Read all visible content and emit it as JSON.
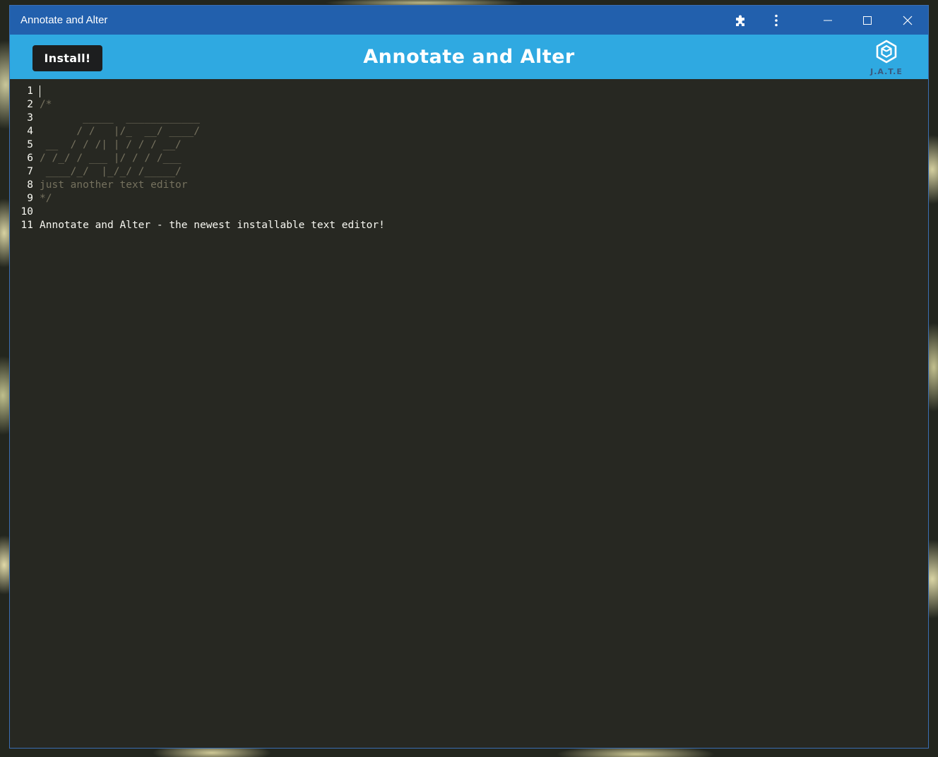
{
  "window": {
    "title": "Annotate and Alter",
    "extensions_icon": "puzzle-icon",
    "menu_icon": "more-vert-icon",
    "minimize_icon": "minimize-icon",
    "maximize_icon": "maximize-icon",
    "close_icon": "close-icon"
  },
  "header": {
    "install_label": "Install!",
    "title": "Annotate and Alter",
    "logo_icon": "jate-logo-icon",
    "logo_text": "J.A.T.E"
  },
  "editor": {
    "lines": [
      {
        "number": "1",
        "text": "",
        "type": "text"
      },
      {
        "number": "2",
        "text": "/*",
        "type": "comment"
      },
      {
        "number": "3",
        "text": "       _____  ____________",
        "type": "comment"
      },
      {
        "number": "4",
        "text": "      / /   |/_  __/ ____/",
        "type": "comment"
      },
      {
        "number": "5",
        "text": " __  / / /| | / / / __/",
        "type": "comment"
      },
      {
        "number": "6",
        "text": "/ /_/ / ___ |/ / / /___",
        "type": "comment"
      },
      {
        "number": "7",
        "text": " ____/_/  |_/_/ /_____/",
        "type": "comment"
      },
      {
        "number": "8",
        "text": "just another text editor",
        "type": "comment"
      },
      {
        "number": "9",
        "text": "*/",
        "type": "comment"
      },
      {
        "number": "10",
        "text": "",
        "type": "text"
      },
      {
        "number": "11",
        "text": "Annotate and Alter - the newest installable text editor!",
        "type": "text"
      }
    ],
    "colors": {
      "background": "#272822",
      "comment": "#75715e",
      "text": "#f8f8f2"
    }
  },
  "colors": {
    "titlebar": "#2260ad",
    "header": "#2fa9e1",
    "install_button": "#1d1e1f"
  }
}
